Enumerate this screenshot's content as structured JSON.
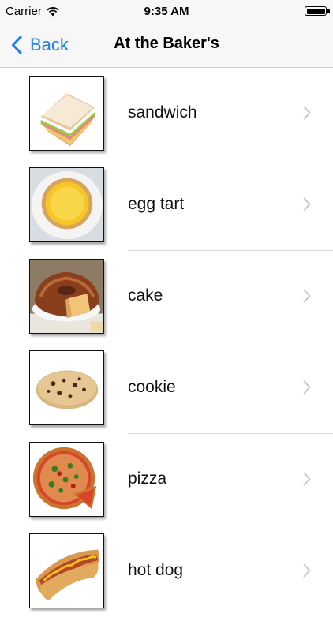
{
  "status_bar": {
    "carrier": "Carrier",
    "time": "9:35 AM"
  },
  "nav": {
    "back_label": "Back",
    "title": "At the Baker's",
    "accent_color": "#1a7cf5"
  },
  "items": [
    {
      "label": "sandwich",
      "icon": "sandwich-image"
    },
    {
      "label": "egg tart",
      "icon": "egg-tart-image"
    },
    {
      "label": "cake",
      "icon": "cake-image"
    },
    {
      "label": "cookie",
      "icon": "cookie-image"
    },
    {
      "label": "pizza",
      "icon": "pizza-image"
    },
    {
      "label": "hot dog",
      "icon": "hot-dog-image"
    }
  ]
}
